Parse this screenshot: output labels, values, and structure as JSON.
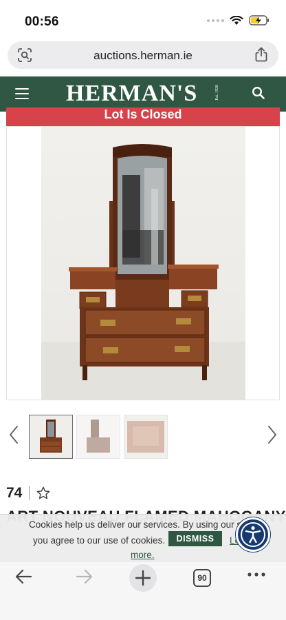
{
  "status_bar": {
    "time": "00:56"
  },
  "browser": {
    "url": "auctions.herman.ie",
    "tab_count": "90"
  },
  "site": {
    "logo": "HERMAN'S",
    "logo_est": "Est. 1928"
  },
  "lot": {
    "status_banner": "Lot Is Closed",
    "number": "74",
    "title": "ART NOUVEAU FLAMED MAHOGANY"
  },
  "cookie": {
    "line1": "Cookies help us deliver our services. By using our serv",
    "line2": "you agree to our use of cookies.",
    "dismiss_label": "DISMISS",
    "learn_label": "Le",
    "more_label": "more."
  },
  "colors": {
    "brand_green": "#2f5743",
    "closed_red": "#d6434b",
    "accessibility_blue": "#163a6e"
  },
  "icons": [
    "lens-icon",
    "share-icon",
    "menu-icon",
    "search-icon",
    "chevron-left-icon",
    "chevron-right-icon",
    "star-icon",
    "accessibility-icon",
    "back-arrow-icon",
    "forward-arrow-icon",
    "plus-icon",
    "more-icon"
  ]
}
